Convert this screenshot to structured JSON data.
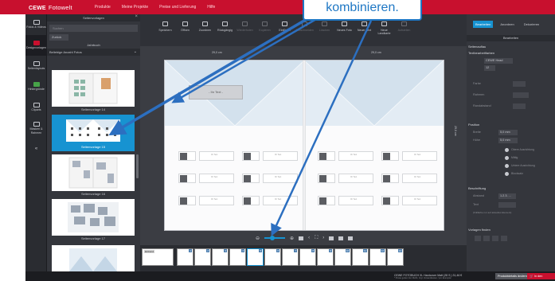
{
  "app": {
    "brand": "CEWE",
    "brand_sub": "Fotowelt",
    "nav": [
      "Produkte",
      "Meine Projekte",
      "Preise und Lieferung",
      "Hilfe"
    ]
  },
  "rail": {
    "items": [
      {
        "label": "Fotos & Videos",
        "icon": "photos-icon"
      },
      {
        "label": "Designvorlagen",
        "icon": "templates-icon",
        "active": true
      },
      {
        "label": "Seitenlayouts",
        "icon": "layouts-icon"
      },
      {
        "label": "Hintergründe",
        "icon": "backgrounds-icon"
      },
      {
        "label": "Cliparts",
        "icon": "cliparts-icon"
      },
      {
        "label": "Masken & Rahmen",
        "icon": "masks-icon"
      },
      {
        "label": "«",
        "icon": "collapse-icon"
      }
    ]
  },
  "left_panel": {
    "title": "Seitenvorlagen",
    "search_placeholder": "Suchen",
    "back_label": "Zurück",
    "category": "Jahrbuch",
    "sort_label": "Beliebige Anzahl Fotos",
    "templates": [
      {
        "label": "Seitenvorlage 14"
      },
      {
        "label": "Seitenvorlage 15",
        "selected": true
      },
      {
        "label": "Seitenvorlage 16"
      },
      {
        "label": "Seitenvorlage 17"
      },
      {
        "label": ""
      }
    ]
  },
  "toolbar": {
    "items": [
      {
        "label": "Speichern",
        "enabled": true
      },
      {
        "label": "Öffnen",
        "enabled": true
      },
      {
        "label": "Zuordnen",
        "enabled": true
      },
      {
        "label": "Rückgängig",
        "enabled": true
      },
      {
        "label": "Wiederholen",
        "enabled": false
      },
      {
        "label": "Kopieren",
        "enabled": false
      },
      {
        "label": "Einfügen",
        "enabled": true
      },
      {
        "label": "Ausschneiden",
        "enabled": false
      },
      {
        "label": "Löschen",
        "enabled": false
      },
      {
        "label": "Neues Foto",
        "enabled": true
      },
      {
        "label": "Neuer Text",
        "enabled": true
      },
      {
        "label": "Neue Landkarte",
        "enabled": true
      },
      {
        "label": "Aufstellen",
        "enabled": false
      }
    ]
  },
  "canvas": {
    "ruler_left": "29,0 cm",
    "ruler_right": "29,0 cm",
    "ruler_vertical": "29,0 cm",
    "text_placeholder": "- Ihr Text -",
    "cell_caption": "Ihr Text"
  },
  "zoom": {
    "minus": "⊖",
    "plus": "⊕",
    "level": 0.4
  },
  "strip": {
    "first_label": "Einband",
    "page_numbers": [
      "1",
      "2",
      "3",
      "4",
      "5",
      "6",
      "7",
      "8",
      "9",
      "10",
      "11",
      "12",
      "13",
      "14",
      "15",
      "16",
      "17",
      "18",
      "19",
      "20",
      "21",
      "22",
      "23",
      "24",
      "25",
      "26"
    ],
    "add_pages": "+ 4 Seiten",
    "remove_pages": "- 4 Seiten",
    "panorama": "+ Panorama"
  },
  "status": {
    "product": "CEWE FOTOBUCH XL Hardcover Matt (28 S.) 31,46 €",
    "note": "* Preise gelten inkl. MwSt. zzgl. Versandkosten / pro Exemplar",
    "details_btn": "Produktdetails ändern",
    "cart_btn": "In den Warenkorb"
  },
  "right_panel": {
    "tabs": [
      "Bearbeiten",
      "Anordnen",
      "Dekorieren"
    ],
    "header": "Bearbeiten",
    "s1_title": "Seitenauflau",
    "s2_title": "Textbearbeitfarben",
    "font": "CEWE Head",
    "font_size": "12",
    "rows": [
      "Farbe",
      "Rahmen",
      "Randabstand"
    ],
    "position_title": "Position",
    "position_fields": [
      "Breite",
      "Höhe",
      "Abstand"
    ],
    "position_values": [
      "5,0 mm",
      "5,0 mm"
    ],
    "radios": [
      "Obere Ausrichtung",
      "Mittig",
      "Untere Ausrichtung",
      "Blocksatz"
    ],
    "caption_title": "Beschriftung",
    "caption_rows": [
      "Abstand",
      "Text"
    ],
    "caption_value": "1.2.3. ...",
    "caption_hint": "(Füllfarbe nur auf aktuelles Element)",
    "templates_title": "Vorlagen finden"
  },
  "tutorial": {
    "callout": "kombinieren.",
    "accent": "#1e77c4"
  }
}
